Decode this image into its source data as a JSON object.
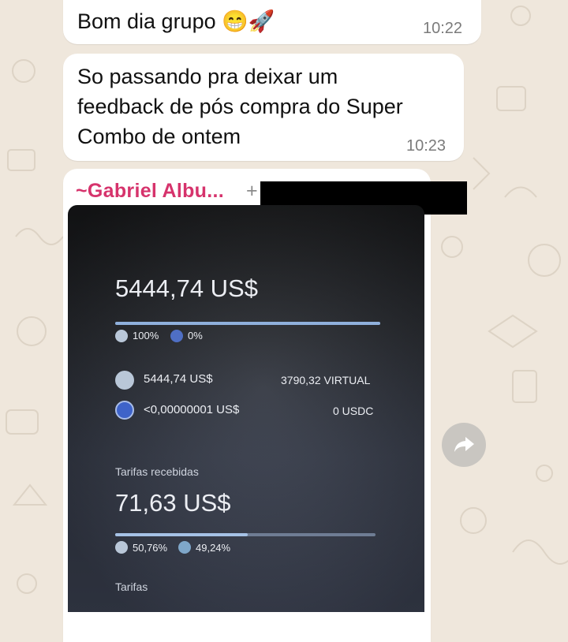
{
  "messages": [
    {
      "text": "Bom dia grupo 😁🚀",
      "time": "10:22"
    },
    {
      "line1": "So passando pra deixar um",
      "line2": "feedback de pós compra do Super",
      "line3": "Combo de ontem",
      "time": "10:23"
    }
  ],
  "media_message": {
    "sender": "~Gabriel Albu...",
    "phone_prefix": "+",
    "screen": {
      "balance": "5444,74 US$",
      "split_a": "100%",
      "split_b": "0%",
      "split_fill": 1.0,
      "row1_left": "5444,74 US$",
      "row1_right": "3790,32 VIRTUAL",
      "row2_left": "<0,00000001 US$",
      "row2_right": "0 USDC",
      "fees_label": "Tarifas recebidas",
      "fees_value": "71,63 US$",
      "fees_split_a": "50,76%",
      "fees_split_b": "49,24%",
      "fees_split_fill": 0.5076,
      "fees_section": "Tarifas"
    }
  },
  "icons": {
    "forward": "forward-arrow-icon",
    "coin_a": "virtual-coin-icon",
    "coin_b": "usdc-coin-icon"
  },
  "colors": {
    "bubble": "#ffffff",
    "sender": "#d6336c",
    "background": "#efe7dc"
  }
}
